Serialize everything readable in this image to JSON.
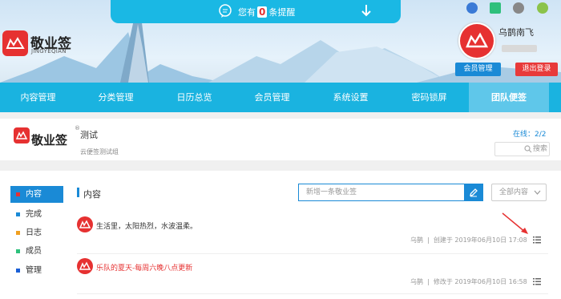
{
  "notice": {
    "prefix": "您有",
    "count": "0",
    "suffix": "条提醒"
  },
  "brand": {
    "name": "敬业签",
    "sub": "JINGYEQIAN"
  },
  "user": {
    "name": "乌鹊南飞",
    "member_btn": "会员管理",
    "logout_btn": "退出登录"
  },
  "nav": [
    {
      "label": "内容管理"
    },
    {
      "label": "分类管理"
    },
    {
      "label": "日历总览"
    },
    {
      "label": "会员管理"
    },
    {
      "label": "系统设置"
    },
    {
      "label": "密码锁屏"
    },
    {
      "label": "团队便签"
    }
  ],
  "team": {
    "brand": "敬业签",
    "reg": "®",
    "name": "测试",
    "desc": "云便签测试组",
    "online_label": "在线：",
    "online_count": "2",
    "online_total": "/2",
    "search": "搜索"
  },
  "sidebar": [
    {
      "label": "内容",
      "color": "#e63131"
    },
    {
      "label": "完成",
      "color": "#1a8ad6"
    },
    {
      "label": "日志",
      "color": "#f0a020"
    },
    {
      "label": "成员",
      "color": "#2ec07c"
    },
    {
      "label": "管理",
      "color": "#1a5fd6"
    }
  ],
  "main": {
    "title": "内容",
    "new_placeholder": "新增一条敬业签",
    "filter": "全部内容"
  },
  "notes": [
    {
      "text": "生活里，太阳热烈，水波温柔。",
      "color": "#333333",
      "author": "乌鹊",
      "action": "创建于 2019年06月10日 17:08"
    },
    {
      "text": "乐队的夏天-每周六晚八点更新",
      "color": "#e63131",
      "author": "乌鹊",
      "action": "修改于 2019年06月10日 16:58"
    }
  ],
  "colors": {
    "accent": "#1ab3e0",
    "brand_red": "#e63131",
    "blue": "#1a8ad6"
  }
}
